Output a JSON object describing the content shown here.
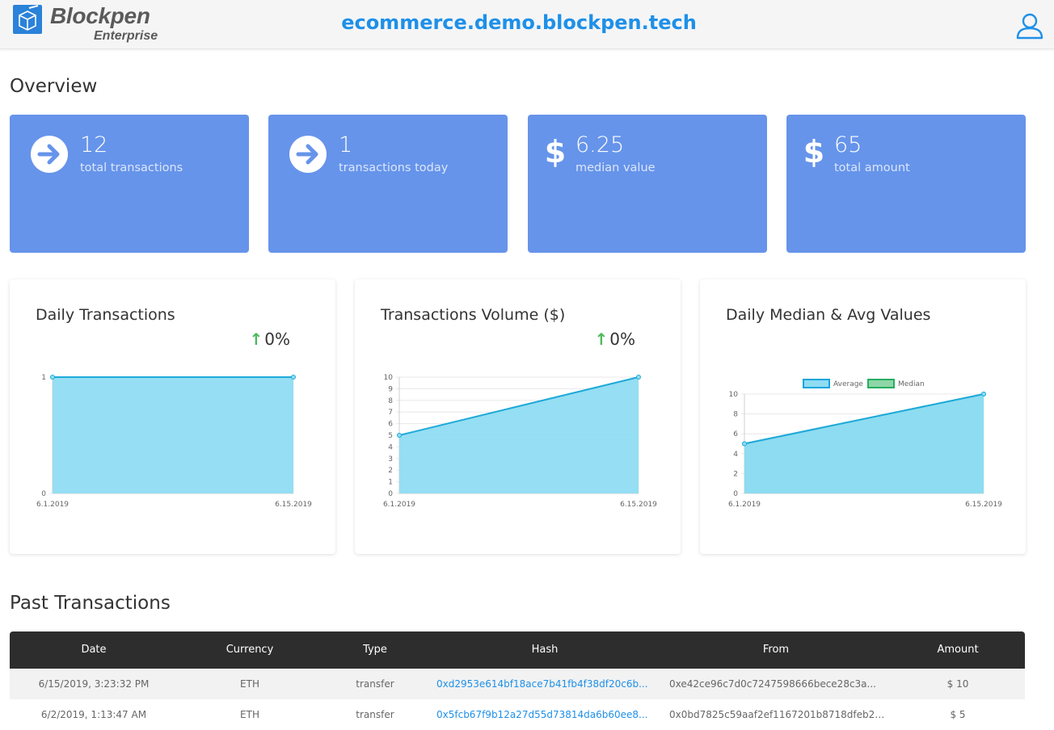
{
  "header": {
    "brand": "Blockpen",
    "brand_sub": "Enterprise",
    "domain": "ecommerce.demo.blockpen.tech"
  },
  "overview": {
    "title": "Overview",
    "cards": [
      {
        "icon": "arrow-right-circle-icon",
        "value": "12",
        "label": "total transactions"
      },
      {
        "icon": "arrow-right-circle-icon",
        "value": "1",
        "label": "transactions today"
      },
      {
        "icon": "dollar-icon",
        "value": "6.25",
        "label": "median value"
      },
      {
        "icon": "dollar-icon",
        "value": "65",
        "label": "total amount"
      }
    ]
  },
  "charts": {
    "daily_transactions": {
      "title": "Daily Transactions",
      "change": "0%"
    },
    "transactions_volume": {
      "title": "Transactions Volume ($)",
      "change": "0%"
    },
    "median_avg": {
      "title": "Daily Median & Avg Values"
    }
  },
  "chart_data": [
    {
      "type": "area",
      "title": "Daily Transactions",
      "x": [
        "6.1.2019",
        "6.15.2019"
      ],
      "series": [
        {
          "values": [
            1,
            1
          ]
        }
      ],
      "ylim": [
        0,
        1
      ],
      "yticks": [
        0,
        1
      ],
      "grid": true
    },
    {
      "type": "area",
      "title": "Transactions Volume ($)",
      "x": [
        "6.1.2019",
        "6.15.2019"
      ],
      "series": [
        {
          "values": [
            5,
            10
          ]
        }
      ],
      "ylim": [
        0,
        10
      ],
      "yticks": [
        0,
        1,
        2,
        3,
        4,
        5,
        6,
        7,
        8,
        9,
        10
      ],
      "grid": true
    },
    {
      "type": "area",
      "title": "Daily Median & Avg Values",
      "x": [
        "6.1.2019",
        "6.15.2019"
      ],
      "series": [
        {
          "name": "Average",
          "values": [
            5,
            10
          ],
          "color": "#8fdcf2"
        },
        {
          "name": "Median",
          "values": [
            5,
            10
          ],
          "color": "#5ccfcf"
        }
      ],
      "ylim": [
        0,
        10
      ],
      "yticks": [
        0,
        2,
        4,
        6,
        8,
        10
      ],
      "legend": "top",
      "grid": true
    }
  ],
  "past": {
    "title": "Past Transactions",
    "columns": [
      "Date",
      "Currency",
      "Type",
      "Hash",
      "From",
      "Amount"
    ],
    "rows": [
      {
        "date": "6/15/2019, 3:23:32 PM",
        "currency": "ETH",
        "type": "transfer",
        "hash": "0xd2953e614bf18ace7b41fb4f38df20c6b...",
        "from": "0xe42ce96c7d0c7247598666bece28c3a...",
        "amount": "$ 10"
      },
      {
        "date": "6/2/2019, 1:13:47 AM",
        "currency": "ETH",
        "type": "transfer",
        "hash": "0x5fcb67f9b12a27d55d73814da6b60ee8...",
        "from": "0x0bd7825c59aaf2ef1167201b8718dfeb27...",
        "amount": "$ 5"
      }
    ]
  },
  "colors": {
    "header_domain": "#1e90e8",
    "card_bg": "#6694ea",
    "area_blue": "#8fdcf2",
    "line_blue": "#1fa9d8",
    "area_teal": "#5ccfcf",
    "arrow_up": "#4cba5a",
    "table_head": "#2d2d2d"
  }
}
